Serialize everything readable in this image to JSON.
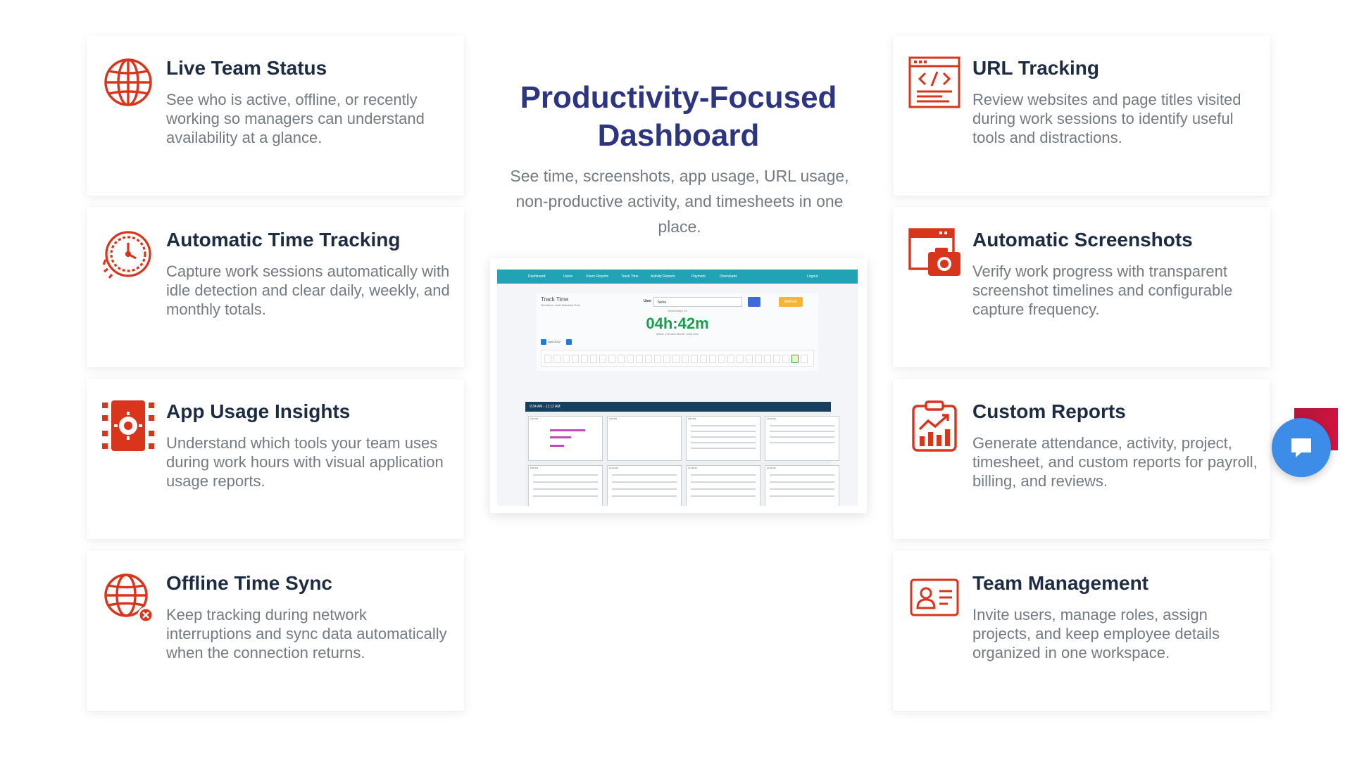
{
  "features_left": [
    {
      "title": "Live Team Status",
      "description": "See who is active, offline, or recently working so managers can understand availability at a glance.",
      "icon": "globe-icon"
    },
    {
      "title": "Automatic Time Tracking",
      "description": "Capture work sessions automatically with idle detection and clear daily, weekly, and monthly totals.",
      "icon": "clock-icon"
    },
    {
      "title": "App Usage Insights",
      "description": "Understand which tools your team uses during work hours with visual application usage reports.",
      "icon": "app-settings-icon"
    },
    {
      "title": "Offline Time Sync",
      "description": "Keep tracking during network interruptions and sync data automatically when the connection returns.",
      "icon": "globe-offline-icon"
    }
  ],
  "features_right": [
    {
      "title": "URL Tracking",
      "description": "Review websites and page titles visited during work sessions to identify useful tools and distractions.",
      "icon": "code-browser-icon"
    },
    {
      "title": "Automatic Screenshots",
      "description": "Verify work progress with transparent screenshot timelines and configurable capture frequency.",
      "icon": "camera-browser-icon"
    },
    {
      "title": "Custom Reports",
      "description": "Generate attendance, activity, project, timesheet, and custom reports for payroll, billing, and reviews.",
      "icon": "report-clipboard-icon"
    },
    {
      "title": "Team Management",
      "description": "Invite users, manage roles, assign projects, and keep employee details organized in one workspace.",
      "icon": "id-card-icon"
    }
  ],
  "hero": {
    "title": "Productivity-Focused Dashboard",
    "subtitle": "See time, screenshots, app usage, URL usage, non-productive activity, and timesheets in one place."
  },
  "screenshot": {
    "nav": [
      "Dashboard",
      "Users",
      "Users Reports",
      "Track Time",
      "Activity Reports",
      "Payment",
      "Downloads"
    ],
    "logout": "Logout",
    "track_time_title": "Track Time",
    "timezone": "TimeZone: India Standard Time",
    "user_label": "User",
    "user_value": "Neha",
    "refresh_label": "Refresh",
    "date": "Wednesday, 26",
    "timer": "04h:42m",
    "week_month": "Week: 12h 08m   Month: 102h 20m",
    "month_label": "April 2022",
    "gallery_header": "9:34 AM - 11:12 AM",
    "thumb_labels": [
      "9:40 AM",
      "9:48 AM",
      "9:56 AM",
      "10:04 AM",
      "9:58 AM",
      "10:10 AM",
      "10:18 AM",
      "10:26 AM"
    ]
  },
  "colors": {
    "icon_accent": "#d9341c",
    "title": "#1e2c42",
    "hero_title": "#2d3480",
    "body_text": "#747a80",
    "chat_button": "#3d8ce8"
  },
  "chat_widget": {
    "icon": "chat-bubble-icon"
  }
}
